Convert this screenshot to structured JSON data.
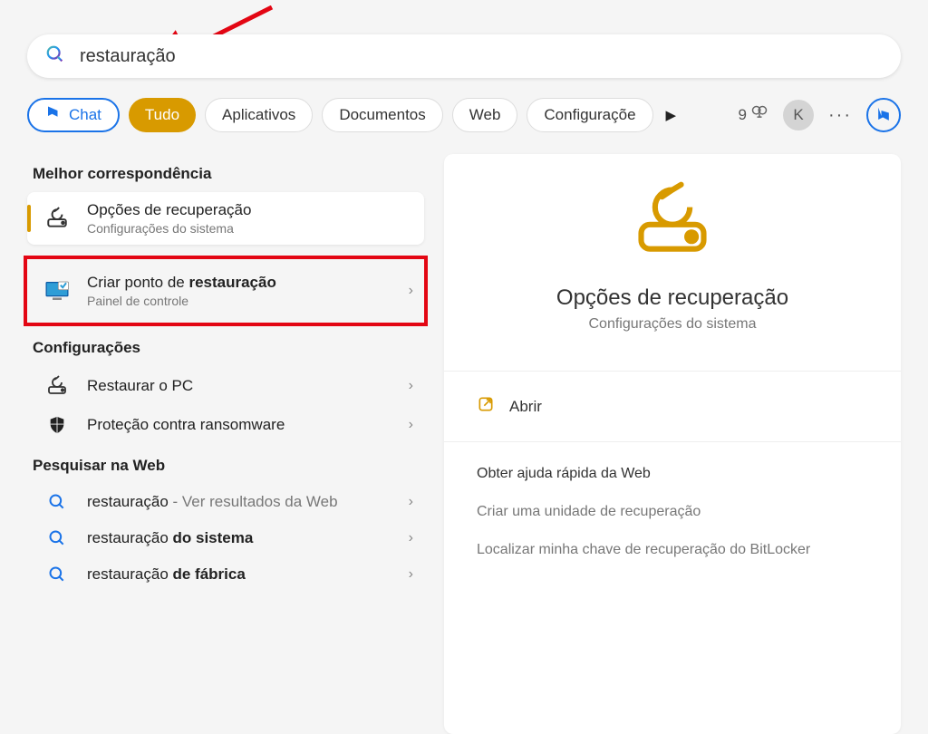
{
  "search": {
    "query": "restauração"
  },
  "filters": {
    "chat": "Chat",
    "all": "Tudo",
    "apps": "Aplicativos",
    "docs": "Documentos",
    "web": "Web",
    "settings": "Configuraçõe"
  },
  "rewards_count": "9",
  "avatar_initial": "K",
  "sections": {
    "best_match": "Melhor correspondência",
    "settings": "Configurações",
    "web": "Pesquisar na Web"
  },
  "results": {
    "best1": {
      "title": "Opções de recuperação",
      "sub": "Configurações do sistema"
    },
    "best2": {
      "title_pre": "Criar ponto de ",
      "title_bold": "restauração",
      "sub": "Painel de controle"
    },
    "cfg1": {
      "title": "Restaurar o PC"
    },
    "cfg2": {
      "title": "Proteção contra ransomware"
    },
    "web1": {
      "title": "restauração",
      "hint": " - Ver resultados da Web"
    },
    "web2": {
      "pre": "restauração ",
      "bold": "do sistema"
    },
    "web3": {
      "pre": "restauração ",
      "bold": "de fábrica"
    }
  },
  "detail": {
    "title": "Opções de recuperação",
    "sub": "Configurações do sistema",
    "open": "Abrir",
    "help_title": "Obter ajuda rápida da Web",
    "help1": "Criar uma unidade de recuperação",
    "help2": "Localizar minha chave de recuperação do BitLocker"
  },
  "colors": {
    "accent": "#d89a00",
    "blue": "#1a73e8",
    "highlight": "#e30613"
  }
}
